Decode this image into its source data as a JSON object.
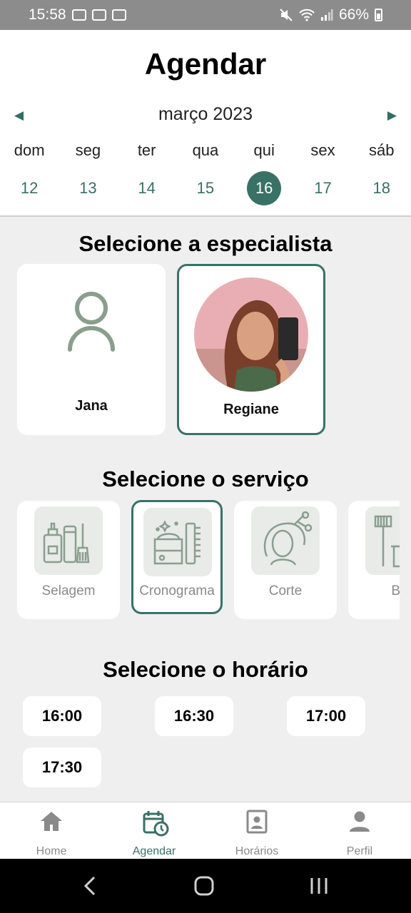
{
  "status_bar": {
    "time": "15:58",
    "battery": "66%"
  },
  "header": {
    "title": "Agendar",
    "month": "março 2023",
    "prev_icon": "◀",
    "next_icon": "▶"
  },
  "calendar": {
    "weekdays": [
      "dom",
      "seg",
      "ter",
      "qua",
      "qui",
      "sex",
      "sáb"
    ],
    "days": [
      "12",
      "13",
      "14",
      "15",
      "16",
      "17",
      "18"
    ],
    "selected_day": "16"
  },
  "specialists": {
    "title": "Selecione a especialista",
    "items": [
      {
        "name": "Jana",
        "icon": "person-outline-icon"
      },
      {
        "name": "Regiane",
        "icon": "profile-photo"
      }
    ],
    "selected": "Regiane"
  },
  "services": {
    "title": "Selecione o serviço",
    "items": [
      {
        "label": "Selagem",
        "icon": "hair-products-icon"
      },
      {
        "label": "Cronograma",
        "icon": "hair-treatment-icon"
      },
      {
        "label": "Corte",
        "icon": "haircut-icon"
      },
      {
        "label": "Bo",
        "icon": "hair-dye-icon"
      }
    ],
    "selected": "Cronograma"
  },
  "times": {
    "title": "Selecione o horário",
    "slots": [
      "16:00",
      "16:30",
      "17:00",
      "17:30"
    ]
  },
  "nav": {
    "items": [
      {
        "label": "Home",
        "icon": "home-icon"
      },
      {
        "label": "Agendar",
        "icon": "calendar-clock-icon"
      },
      {
        "label": "Horários",
        "icon": "portrait-icon"
      },
      {
        "label": "Perfil",
        "icon": "person-icon"
      }
    ],
    "active": "Agendar"
  },
  "colors": {
    "accent": "#3a7167",
    "icon_green": "#8a9e8e",
    "background": "#efefef"
  }
}
